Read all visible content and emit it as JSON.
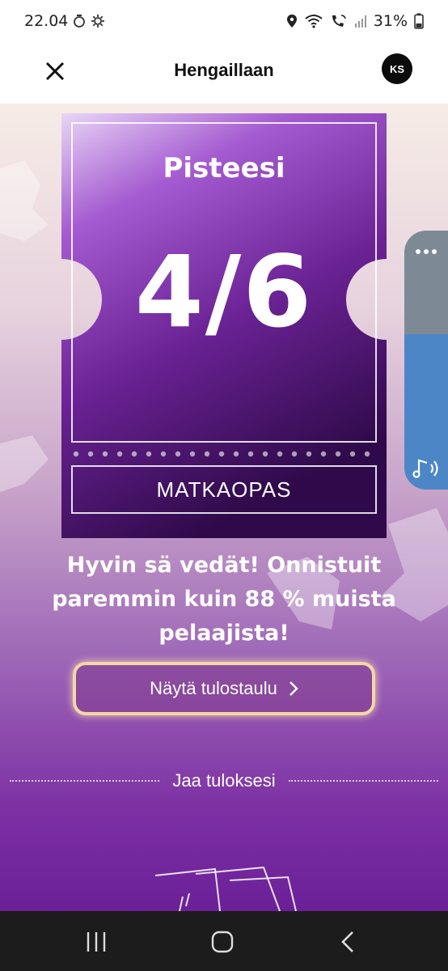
{
  "status_bar": {
    "time": "22.04",
    "battery": "31%",
    "icons_left": [
      "timer-icon",
      "settings-gear-icon"
    ],
    "icons_right": [
      "location-icon",
      "wifi-icon",
      "wifi-calling-icon",
      "signal-icon",
      "battery-icon"
    ]
  },
  "header": {
    "title": "Hengaillaan",
    "avatar_initials": "KS",
    "close_icon": "close-icon"
  },
  "ticket": {
    "title": "Pisteesi",
    "score": "4/6",
    "category": "MATKAOPAS"
  },
  "result": {
    "message": "Hyvin sä vedät! Onnistuit paremmin kuin 88 % muista pelaajista!"
  },
  "leaderboard_button": {
    "label": "Näytä tulostaulu",
    "icon": "chevron-right-icon"
  },
  "share": {
    "label": "Jaa tuloksesi"
  },
  "side_panel": {
    "menu_icon": "more-dots-icon",
    "audio_icon": "audio-note-icon"
  },
  "nav": {
    "items": [
      "recent-apps-icon",
      "home-icon",
      "back-icon"
    ]
  },
  "colors": {
    "accent_gold": "#f2d7a8",
    "ticket_purple": "#6a2294",
    "side_blue": "#4d86c7"
  }
}
